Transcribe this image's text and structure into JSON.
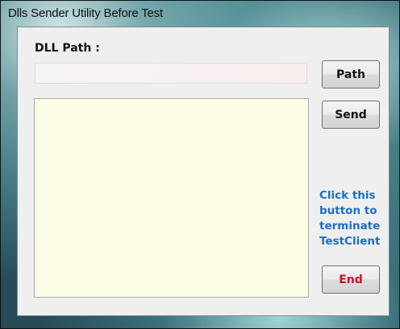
{
  "window": {
    "title": "Dlls Sender Utility Before Test"
  },
  "form": {
    "dll_path_label": "DLL Path :",
    "dll_path_value": "",
    "output_text": "",
    "path_button_label": "Path",
    "send_button_label": "Send",
    "hint_lines": [
      "Click this",
      "button to",
      "terminate",
      "TestClient"
    ],
    "end_button_label": "End"
  },
  "colors": {
    "hint_text": "#1b6fc4",
    "end_button_text": "#c8102e",
    "output_background": "#fdfde6"
  }
}
